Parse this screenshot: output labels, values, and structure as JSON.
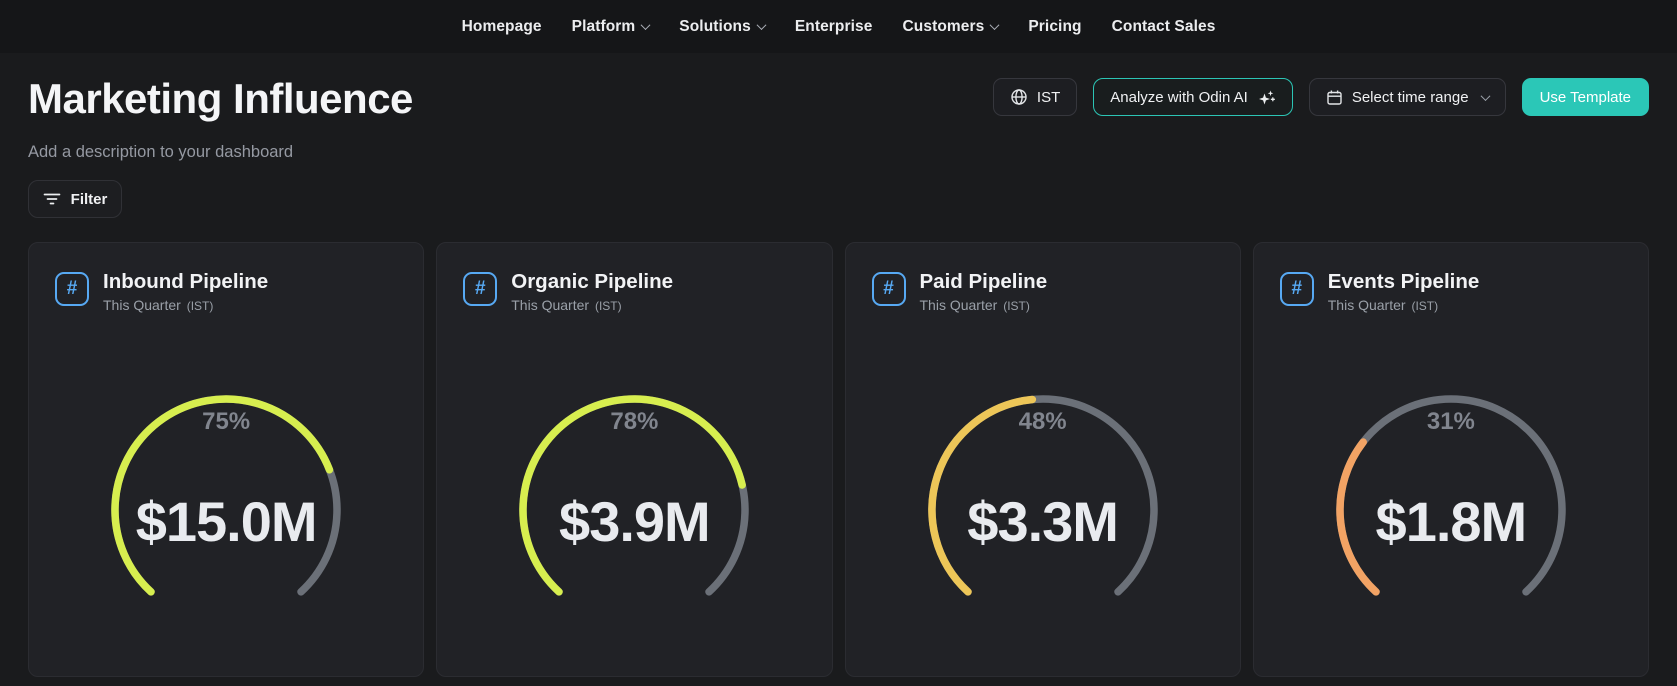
{
  "nav": {
    "items": [
      {
        "label": "Homepage",
        "dropdown": false
      },
      {
        "label": "Platform",
        "dropdown": true
      },
      {
        "label": "Solutions",
        "dropdown": true
      },
      {
        "label": "Enterprise",
        "dropdown": false
      },
      {
        "label": "Customers",
        "dropdown": true
      },
      {
        "label": "Pricing",
        "dropdown": false
      },
      {
        "label": "Contact Sales",
        "dropdown": false
      }
    ]
  },
  "header": {
    "title": "Marketing Influence",
    "subtitle": "Add a description to your dashboard",
    "timezone_button": "IST",
    "analyze_button": "Analyze with Odin AI",
    "time_range_button": "Select time range",
    "use_template_button": "Use Template",
    "filter_button": "Filter"
  },
  "colors": {
    "accent_teal": "#2bc7b7",
    "icon_blue": "#57a9f3",
    "track_gray": "#6b7078",
    "lime": "#d7ee4f",
    "amber": "#edc658",
    "orange": "#f2a364"
  },
  "cards": [
    {
      "title": "Inbound Pipeline",
      "subtitle": "This Quarter",
      "subtitle_suffix": "(IST)",
      "gauge": {
        "percent": 75,
        "percent_label": "75%",
        "value": "$15.0M",
        "color": "#d7ee4f"
      }
    },
    {
      "title": "Organic Pipeline",
      "subtitle": "This Quarter",
      "subtitle_suffix": "(IST)",
      "gauge": {
        "percent": 78,
        "percent_label": "78%",
        "value": "$3.9M",
        "color": "#d7ee4f"
      }
    },
    {
      "title": "Paid Pipeline",
      "subtitle": "This Quarter",
      "subtitle_suffix": "(IST)",
      "gauge": {
        "percent": 48,
        "percent_label": "48%",
        "value": "$3.3M",
        "color": "#edc658"
      }
    },
    {
      "title": "Events Pipeline",
      "subtitle": "This Quarter",
      "subtitle_suffix": "(IST)",
      "gauge": {
        "percent": 31,
        "percent_label": "31%",
        "value": "$1.8M",
        "color": "#f2a364"
      }
    }
  ],
  "chart_data": [
    {
      "type": "gauge",
      "title": "Inbound Pipeline",
      "subtitle": "This Quarter (IST)",
      "percent": 75,
      "value": "$15.0M",
      "min": 0,
      "max": 100,
      "arc_color": "#d7ee4f",
      "track_color": "#6b7078"
    },
    {
      "type": "gauge",
      "title": "Organic Pipeline",
      "subtitle": "This Quarter (IST)",
      "percent": 78,
      "value": "$3.9M",
      "min": 0,
      "max": 100,
      "arc_color": "#d7ee4f",
      "track_color": "#6b7078"
    },
    {
      "type": "gauge",
      "title": "Paid Pipeline",
      "subtitle": "This Quarter (IST)",
      "percent": 48,
      "value": "$3.3M",
      "min": 0,
      "max": 100,
      "arc_color": "#edc658",
      "track_color": "#6b7078"
    },
    {
      "type": "gauge",
      "title": "Events Pipeline",
      "subtitle": "This Quarter (IST)",
      "percent": 31,
      "value": "$1.8M",
      "min": 0,
      "max": 100,
      "arc_color": "#f2a364",
      "track_color": "#6b7078"
    }
  ]
}
